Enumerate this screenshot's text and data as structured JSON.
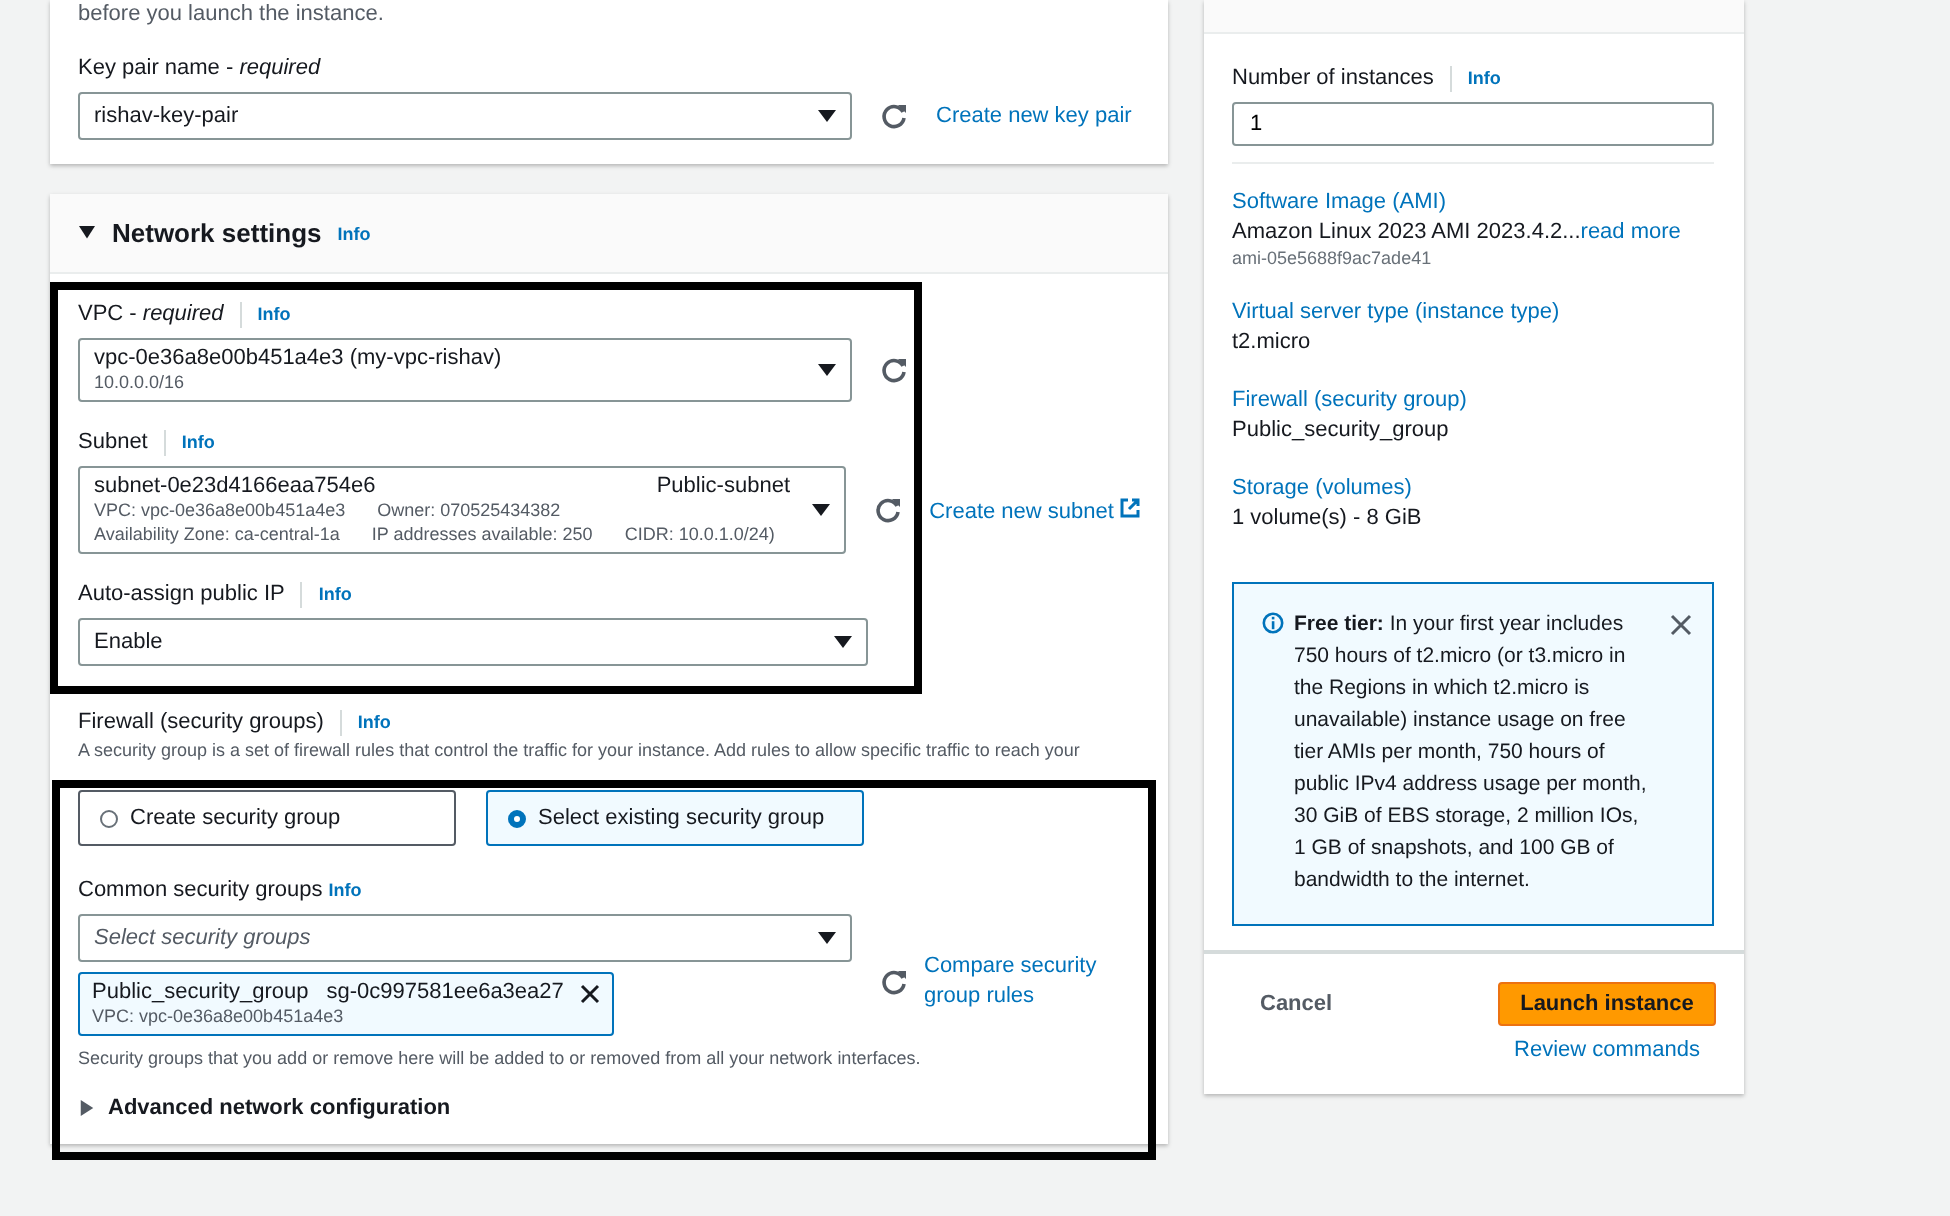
{
  "key_pair": {
    "intro": "before you launch the instance.",
    "label": "Key pair name - *required*",
    "value": "rishav-key-pair",
    "link": "Create new key pair"
  },
  "network_settings": {
    "title": "Network settings",
    "info": "Info",
    "expanded": true,
    "vpc": {
      "label": "VPC - *required*",
      "info": "Info",
      "value": "vpc-0e36a8e00b451a4e3 (my-vpc-rishav)",
      "detail": "10.0.0.0/16"
    },
    "subnet": {
      "label": "Subnet",
      "info": "Info",
      "value": "subnet-0e23d4166eaa754e6",
      "name": "Public-subnet",
      "detail_rows": [
        [
          "VPC: vpc-0e36a8e00b451a4e3",
          "Owner: 070525434382"
        ],
        [
          "Availability Zone: ca-central-1a",
          "IP addresses available: 250",
          "CIDR: 10.0.1.0/24)"
        ]
      ],
      "link": "Create new subnet"
    },
    "auto_assign_ip": {
      "label": "Auto-assign public IP",
      "info": "Info",
      "value": "Enable"
    },
    "firewall": {
      "label": "Firewall (security groups)",
      "info": "Info",
      "description": "A security group is a set of firewall rules that control the traffic for your instance. Add rules to allow specific traffic to reach your",
      "options": [
        {
          "label": "Create security group",
          "selected": false
        },
        {
          "label": "Select existing security group",
          "selected": true
        }
      ],
      "common_label": "Common security groups",
      "common_info": "Info",
      "placeholder": "Select security groups",
      "chips": [
        {
          "name": "Public_security_group",
          "id": "sg-0c997581ee6a3ea27",
          "vpc": "VPC: vpc-0e36a8e00b451a4e3"
        }
      ],
      "compare_link": "Compare security group rules",
      "hint": "Security groups that you add or remove here will be added to or removed from all your network interfaces."
    },
    "advanced": {
      "label": "Advanced network configuration",
      "expanded": false
    }
  },
  "summary": {
    "instances_label": "Number of instances",
    "instances_info": "Info",
    "instances_value": "1",
    "items": [
      {
        "label": "Software Image (AMI)",
        "value": "Amazon Linux 2023 AMI 2023.4.2...",
        "link": "read more",
        "sub": "ami-05e5688f9ac7ade41"
      },
      {
        "label": "Virtual server type (instance type)",
        "value": "t2.micro"
      },
      {
        "label": "Firewall (security group)",
        "value": "Public_security_group"
      },
      {
        "label": "Storage (volumes)",
        "value": "1 volume(s) - 8 GiB"
      }
    ],
    "alert": "**Free tier:** In your first year includes 750 hours of t2.micro (or t3.micro in the Regions in which t2.micro is unavailable) instance usage on free tier AMIs per month, 750 hours of public IPv4 address usage per month, 30 GiB of EBS storage, 2 million IOs, 1 GB of snapshots, and 100 GB of bandwidth to the internet.",
    "cancel": "Cancel",
    "launch": "Launch instance",
    "review": "Review commands"
  }
}
